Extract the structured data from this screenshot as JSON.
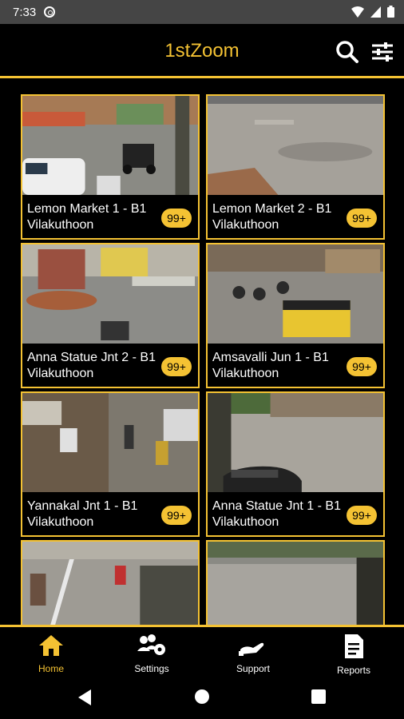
{
  "status_bar": {
    "time": "7:33"
  },
  "app": {
    "title": "1stZoom"
  },
  "cameras": [
    {
      "title": "Lemon Market 1 - B1",
      "location": "Vilakuthoon",
      "badge": "99+"
    },
    {
      "title": "Lemon Market 2 - B1",
      "location": "Vilakuthoon",
      "badge": "99+"
    },
    {
      "title": "Anna Statue Jnt 2 - B1",
      "location": "Vilakuthoon",
      "badge": "99+"
    },
    {
      "title": "Amsavalli Jun 1 - B1",
      "location": "Vilakuthoon",
      "badge": "99+"
    },
    {
      "title": "Yannakal Jnt 1 - B1",
      "location": "Vilakuthoon",
      "badge": "99+"
    },
    {
      "title": "Anna Statue Jnt 1 - B1",
      "location": "Vilakuthoon",
      "badge": "99+"
    }
  ],
  "bottom_nav": {
    "items": [
      {
        "label": "Home",
        "icon": "home-icon",
        "active": true
      },
      {
        "label": "Settings",
        "icon": "settings-icon",
        "active": false
      },
      {
        "label": "Support",
        "icon": "support-icon",
        "active": false
      },
      {
        "label": "Reports",
        "icon": "reports-icon",
        "active": false
      }
    ]
  },
  "colors": {
    "accent": "#f4c233",
    "background": "#000000",
    "status_bar": "#454545"
  }
}
